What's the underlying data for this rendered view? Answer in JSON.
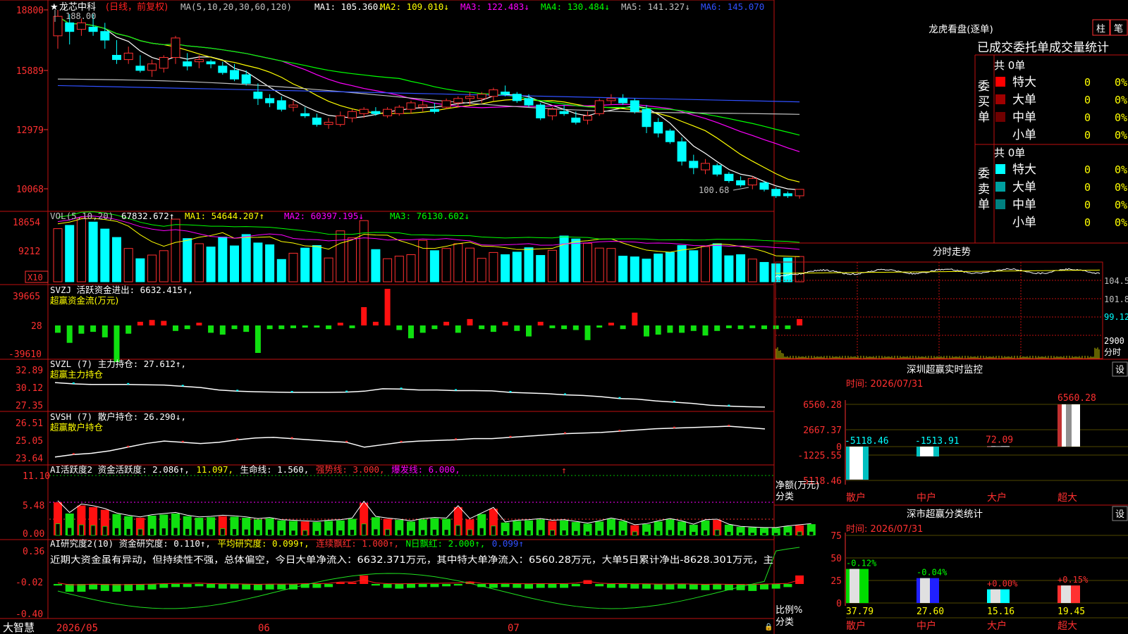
{
  "app": {
    "brand": "大智慧"
  },
  "main": {
    "stock_name": "龙芯中科",
    "star": "★",
    "period": "(日线，前复权)",
    "ma_title": "MA(5,10,20,30,60,120)",
    "ma": [
      {
        "text": "MA1: 105.360↓",
        "color": "#ffffff"
      },
      {
        "text": "MA2: 109.010↓",
        "color": "#ffff00"
      },
      {
        "text": "MA3: 122.483↓",
        "color": "#ff00ff"
      },
      {
        "text": "MA4: 130.484↓",
        "color": "#00ff00"
      },
      {
        "text": "MA5: 141.327↓",
        "color": "#c0c0c0"
      },
      {
        "text": "MA6: 145.070",
        "color": "#3050ff"
      }
    ],
    "price_axis": [
      "18800",
      "15889",
      "12979",
      "10068"
    ],
    "high_label": "188.00",
    "low_label": "100.68",
    "x_axis": [
      "2026/05",
      "06",
      "07"
    ]
  },
  "vol": {
    "title": "VOL(5,10,20)",
    "value": "67832.672↑",
    "ma": [
      {
        "text": "MA1: 54644.207↑",
        "color": "#ffff00"
      },
      {
        "text": "MA2: 60397.195↓",
        "color": "#ff00ff"
      },
      {
        "text": "MA3: 76130.602↓",
        "color": "#00ff00"
      }
    ],
    "axis": [
      "18654",
      "9212"
    ],
    "unit": "X10"
  },
  "svzj": {
    "line1": "SVZJ  活跃资金进出: 6632.415↑,",
    "line2": "超赢资金流(万元)",
    "axis": [
      "39665",
      "28",
      "-39610"
    ]
  },
  "svzl": {
    "line1": "SVZL (7) 主力持仓: 27.612↑,",
    "line2": "超赢主力持仓",
    "axis": [
      "32.89",
      "30.12",
      "27.35"
    ]
  },
  "svsh": {
    "line1": "SVSH (7) 散户持仓: 26.290↓,",
    "line2": "超赢散户持仓",
    "axis": [
      "26.51",
      "25.05",
      "23.64"
    ]
  },
  "ai2": {
    "title": "AI活跃度2 资金活跃度: 2.086↑,",
    "v2": "11.097,",
    "life": "生命线: 1.560,",
    "strong": "强势线: 3.000,",
    "burst": "爆发线: 6.000,",
    "axis": [
      "11.10",
      "5.48",
      "0.00"
    ]
  },
  "ai_research": {
    "title": "AI研究度2(10) 资金研究度: 0.110↑,",
    "avg": "平均研究度: 0.099↑,",
    "cont": "连续飘红: 1.000↑,",
    "nday": "N日飘红: 2.000↑,",
    "last": "0.099↑",
    "comment": "近期大资金虽有异动，但持续性不强，总体偏空，今日大单净流入：6632.371万元，其中特大单净流入：6560.28万元，大单5日累计净出-8628.301万元，主",
    "axis": [
      "0.36",
      "-0.02",
      "-0.40"
    ]
  },
  "right": {
    "lhb": {
      "title": "龙虎看盘(逐单)",
      "btn1": "柱",
      "btn2": "笔",
      "header": "已成交委托单成交量统计",
      "buy_label": "委买单",
      "sell_label": "委卖单",
      "buy_count": "共 0单",
      "sell_count": "共 0单",
      "buy_rows": [
        {
          "name": "特大",
          "n": "0",
          "p": "0%",
          "color": "#ff0000"
        },
        {
          "name": "大单",
          "n": "0",
          "p": "0%",
          "color": "#a00000"
        },
        {
          "name": "中单",
          "n": "0",
          "p": "0%",
          "color": "#700000"
        },
        {
          "name": "小单",
          "n": "0",
          "p": "0%",
          "color": "#000000"
        }
      ],
      "sell_rows": [
        {
          "name": "特大",
          "n": "0",
          "p": "0%",
          "color": "#00ffff"
        },
        {
          "name": "大单",
          "n": "0",
          "p": "0%",
          "color": "#00a0a0"
        },
        {
          "name": "中单",
          "n": "0",
          "p": "0%",
          "color": "#008080"
        },
        {
          "name": "小单",
          "n": "0",
          "p": "0%",
          "color": "#000000"
        }
      ]
    },
    "intraday": {
      "title": "分时走势",
      "axis": [
        "104.5",
        "101.8",
        "99.12"
      ],
      "vol_value": "2900",
      "vol_unit": "分时"
    },
    "sz_monitor": {
      "title": "深圳超赢实时监控",
      "btn": "设",
      "time": "时间: 2026/07/31",
      "axis": [
        "6560.28",
        "2667.37",
        "0",
        "-1225.55",
        "-5118.46"
      ],
      "y_label": "净额(万元)",
      "x_label": "分类",
      "categories": [
        "散户",
        "中户",
        "大户",
        "超大"
      ],
      "values": [
        -5118.46,
        -1513.91,
        72.09,
        6560.28
      ],
      "value_labels": [
        "-5118.46",
        "-1513.91",
        "72.09",
        "6560.28"
      ]
    },
    "sz_class": {
      "title": "深市超赢分类统计",
      "btn": "设",
      "time": "时间: 2026/07/31",
      "axis": [
        "75",
        "50",
        "25",
        "0"
      ],
      "y_label": "比例%",
      "x_label": "分类",
      "categories": [
        "散户",
        "中户",
        "大户",
        "超大"
      ],
      "values": [
        37.79,
        27.6,
        15.16,
        19.45
      ],
      "value_labels": [
        "37.79",
        "27.60",
        "15.16",
        "19.45"
      ],
      "changes": [
        "-0.12%",
        "-0.04%",
        "+0.00%",
        "+0.15%"
      ],
      "change_colors": [
        "#00ff00",
        "#00ff00",
        "#ff3030",
        "#ff3030"
      ]
    }
  },
  "chart_data": [
    {
      "type": "candlestick",
      "title": "龙芯中科",
      "ylim": [
        100.68,
        188.0
      ],
      "x_ticks": [
        "2026/05",
        "06",
        "07"
      ],
      "ohlc": [
        [
          176,
          188,
          170,
          185
        ],
        [
          182,
          186,
          172,
          178
        ],
        [
          179,
          184,
          176,
          182
        ],
        [
          180,
          186,
          176,
          178
        ],
        [
          178,
          182,
          170,
          174
        ],
        [
          167,
          174,
          163,
          165
        ],
        [
          165,
          171,
          163,
          168
        ],
        [
          162,
          167,
          159,
          160
        ],
        [
          160,
          165,
          157,
          163
        ],
        [
          161,
          167,
          159,
          166
        ],
        [
          166,
          176,
          163,
          175
        ],
        [
          164,
          168,
          160,
          162
        ],
        [
          164,
          167,
          161,
          165
        ],
        [
          164,
          165,
          161,
          163
        ],
        [
          162,
          164,
          158,
          159
        ],
        [
          160,
          163,
          155,
          156
        ],
        [
          158,
          160,
          153,
          154
        ],
        [
          150,
          154,
          144,
          147
        ],
        [
          147,
          149,
          143,
          145
        ],
        [
          146,
          148,
          141,
          142
        ],
        [
          143,
          146,
          141,
          144
        ],
        [
          140,
          143,
          138,
          139
        ],
        [
          138,
          140,
          134,
          135
        ],
        [
          135,
          138,
          133,
          136
        ],
        [
          135,
          141,
          134,
          139
        ],
        [
          138,
          142,
          136,
          141
        ],
        [
          140,
          143,
          138,
          142
        ],
        [
          141,
          143,
          139,
          140
        ],
        [
          139,
          143,
          138,
          142
        ],
        [
          140,
          144,
          139,
          143
        ],
        [
          142,
          146,
          140,
          145
        ],
        [
          143,
          146,
          141,
          144
        ],
        [
          142,
          145,
          140,
          141
        ],
        [
          143,
          147,
          142,
          146
        ],
        [
          145,
          148,
          143,
          147
        ],
        [
          147,
          150,
          144,
          148
        ],
        [
          147,
          150,
          145,
          149
        ],
        [
          148,
          152,
          146,
          151
        ],
        [
          150,
          153,
          148,
          149
        ],
        [
          149,
          150,
          145,
          146
        ],
        [
          147,
          149,
          143,
          144
        ],
        [
          144,
          145,
          137,
          138
        ],
        [
          139,
          143,
          137,
          142
        ],
        [
          141,
          144,
          139,
          140
        ],
        [
          138,
          141,
          135,
          136
        ],
        [
          137,
          141,
          135,
          139
        ],
        [
          140,
          147,
          139,
          146
        ],
        [
          146,
          149,
          144,
          147
        ],
        [
          147,
          149,
          144,
          145
        ],
        [
          146,
          147,
          140,
          141
        ],
        [
          142,
          144,
          131,
          134
        ],
        [
          136,
          138,
          129,
          131
        ],
        [
          132,
          133,
          126,
          127
        ],
        [
          127,
          129,
          116,
          118
        ],
        [
          118,
          121,
          112,
          115
        ],
        [
          114,
          119,
          112,
          117
        ],
        [
          116,
          117,
          111,
          112
        ],
        [
          112,
          113,
          108,
          109
        ],
        [
          109,
          111,
          106,
          107
        ],
        [
          107,
          111,
          105,
          110
        ],
        [
          108,
          109,
          104,
          105
        ],
        [
          105,
          106,
          101,
          102
        ],
        [
          103,
          104,
          101,
          102
        ],
        [
          102,
          105,
          100.68,
          105
        ]
      ],
      "ma_series": [
        "MA5",
        "MA10",
        "MA20",
        "MA30",
        "MA60",
        "MA120"
      ]
    },
    {
      "type": "bar",
      "title": "VOL(5,10,20)",
      "ylim": [
        0,
        18654
      ],
      "values": [
        14500,
        15400,
        17500,
        16300,
        14400,
        12100,
        9100,
        6300,
        7300,
        8500,
        17100,
        11800,
        10400,
        9500,
        12200,
        9800,
        12900,
        10600,
        10100,
        6100,
        7800,
        9200,
        9900,
        6500,
        13900,
        12000,
        16700,
        8800,
        6300,
        7000,
        7400,
        11300,
        8500,
        9100,
        10400,
        9200,
        6400,
        8000,
        7400,
        8100,
        9300,
        7200,
        8600,
        12500,
        11700,
        10500,
        9200,
        9100,
        7000,
        6800,
        6200,
        7600,
        8000,
        9900,
        8500,
        9600,
        10400,
        7100,
        7400,
        6200,
        5300,
        4900,
        6500,
        6900
      ]
    },
    {
      "type": "bar",
      "title": "SVZJ 活跃资金进出",
      "ylim": [
        -39610,
        39665
      ],
      "values": [
        -8000,
        -19000,
        -9000,
        -7000,
        -13000,
        -40000,
        -9000,
        4000,
        6000,
        5000,
        -6000,
        -4000,
        3000,
        -8000,
        -10000,
        -4000,
        -7000,
        -30000,
        -4000,
        -4000,
        -3000,
        -2000,
        -2000,
        -4000,
        3000,
        -3000,
        20000,
        4000,
        40000,
        -5000,
        -14000,
        -8000,
        -4000,
        4000,
        -8000,
        7000,
        -4000,
        -7000,
        4000,
        -6000,
        -12000,
        4000,
        -3000,
        -4000,
        -5000,
        -16000,
        -2000,
        3000,
        -4000,
        14000,
        -12000,
        -10000,
        -8000,
        -8000,
        -6000,
        -11000,
        -6000,
        -3000,
        -4000,
        -3000,
        -4000,
        -4000,
        -4000,
        7000
      ]
    },
    {
      "type": "line",
      "title": "SVZL (7) 主力持仓",
      "ylim": [
        27.35,
        32.89
      ],
      "values": [
        31.6,
        31.4,
        31.3,
        31.3,
        31.3,
        31.25,
        31.2,
        31.0,
        30.8,
        30.4,
        30.2,
        30.1,
        30.05,
        30.0,
        30.0,
        30.0,
        30.05,
        30.2,
        30.6,
        30.55,
        30.4,
        30.4,
        30.3,
        30.3,
        30.25,
        30.0,
        29.9,
        29.8,
        29.6,
        29.5,
        29.3,
        29.0,
        28.9,
        28.6,
        28.4,
        28.2,
        27.9,
        27.75,
        27.65,
        27.6
      ]
    },
    {
      "type": "line",
      "title": "SVSH (7) 散户持仓",
      "ylim": [
        23.64,
        26.51
      ],
      "values": [
        24.0,
        24.2,
        24.3,
        24.5,
        24.8,
        25.1,
        25.3,
        25.2,
        25.1,
        25.2,
        25.4,
        25.55,
        25.6,
        25.5,
        25.4,
        25.3,
        25.2,
        24.8,
        25.0,
        25.2,
        25.3,
        25.35,
        25.4,
        25.5,
        25.5,
        25.6,
        25.7,
        25.8,
        25.9,
        25.95,
        26.0,
        26.1,
        26.2,
        26.3,
        26.35,
        26.4,
        26.45,
        26.51,
        26.4,
        26.29
      ]
    },
    {
      "type": "bar",
      "title": "AI活跃度2",
      "ylim": [
        0,
        11.1
      ],
      "values": [
        6.2,
        4.1,
        5.6,
        5.3,
        4.8,
        4.0,
        3.6,
        3.3,
        3.7,
        3.9,
        4.1,
        3.6,
        3.3,
        3.4,
        3.6,
        3.5,
        3.3,
        3.0,
        3.2,
        2.8,
        2.7,
        2.6,
        2.5,
        2.7,
        2.8,
        3.1,
        6.1,
        3.4,
        3.1,
        2.9,
        2.6,
        3.0,
        3.2,
        3.1,
        5.3,
        3.0,
        4.0,
        5.0,
        2.4,
        2.7,
        2.8,
        3.0,
        2.7,
        2.8,
        2.5,
        2.2,
        2.6,
        3.1,
        2.7,
        1.9,
        2.1,
        2.6,
        3.0,
        2.6,
        2.0,
        2.8,
        2.9,
        2.0,
        1.6,
        1.5,
        1.4,
        1.4,
        1.7,
        1.9,
        2.1
      ]
    },
    {
      "type": "bar",
      "title": "AI研究度2(10)",
      "ylim": [
        -0.4,
        0.36
      ],
      "values": [
        -0.02,
        -0.1,
        -0.1,
        -0.07,
        -0.09,
        -0.1,
        -0.09,
        -0.08,
        -0.07,
        -0.05,
        -0.04,
        -0.04,
        -0.03,
        -0.05,
        -0.06,
        -0.06,
        -0.07,
        -0.08,
        -0.07,
        -0.07,
        -0.07,
        -0.05,
        -0.05,
        -0.04,
        0.02,
        0.02,
        0.11,
        -0.02,
        -0.05,
        -0.06,
        -0.05,
        -0.04,
        -0.04,
        -0.03,
        -0.02,
        0.03,
        -0.04,
        -0.05,
        -0.04,
        -0.05,
        -0.06,
        -0.05,
        -0.05,
        -0.05,
        -0.03,
        0.05,
        -0.03,
        -0.05,
        -0.05,
        -0.06,
        -0.06,
        -0.07,
        -0.07,
        -0.06,
        -0.07,
        -0.08,
        -0.07,
        -0.08,
        -0.08,
        -0.09,
        -0.07,
        -0.06,
        -0.04,
        0.11
      ]
    }
  ]
}
